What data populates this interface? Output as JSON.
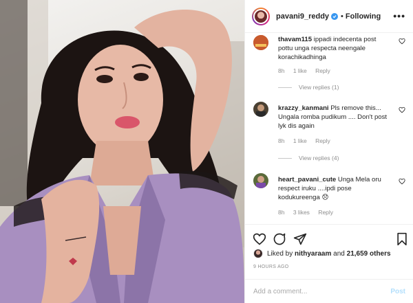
{
  "post": {
    "username": "pavani9_reddy",
    "verified": true,
    "separator": "•",
    "follow_status": "Following",
    "more_label": "•••"
  },
  "comments": [
    {
      "username": "thavam115",
      "text": "ippadi indecenta post pottu unga respecta neengale korachikadhinga",
      "time": "8h",
      "likes": "1 like",
      "reply_label": "Reply",
      "view_replies": "View replies (1)"
    },
    {
      "username": "krazzy_kanmani",
      "text": "Pls remove this... Ungala romba pudikum .... Don't post lyk dis again",
      "time": "8h",
      "likes": "1 like",
      "reply_label": "Reply",
      "view_replies": "View replies (4)"
    },
    {
      "username": "heart_pavani_cute",
      "text": "Unga Mela oru respect iruku ....ipdi pose kodukureenga 😞",
      "time": "8h",
      "likes": "3 likes",
      "reply_label": "Reply"
    }
  ],
  "actions": {
    "icons": [
      "heart-icon",
      "comment-icon",
      "share-icon",
      "bookmark-icon"
    ]
  },
  "likes": {
    "prefix": "Liked by",
    "first_user": "nithyaraam",
    "conjunction": "and",
    "others": "21,659 others"
  },
  "timestamp": "9 HOURS AGO",
  "add_comment": {
    "placeholder": "Add a comment...",
    "post_label": "Post"
  },
  "colors": {
    "accent": "#3897f0",
    "muted": "#8e8e8e",
    "text": "#262626",
    "post_disabled": "#b2dffc",
    "robe": "#a88fc0"
  }
}
